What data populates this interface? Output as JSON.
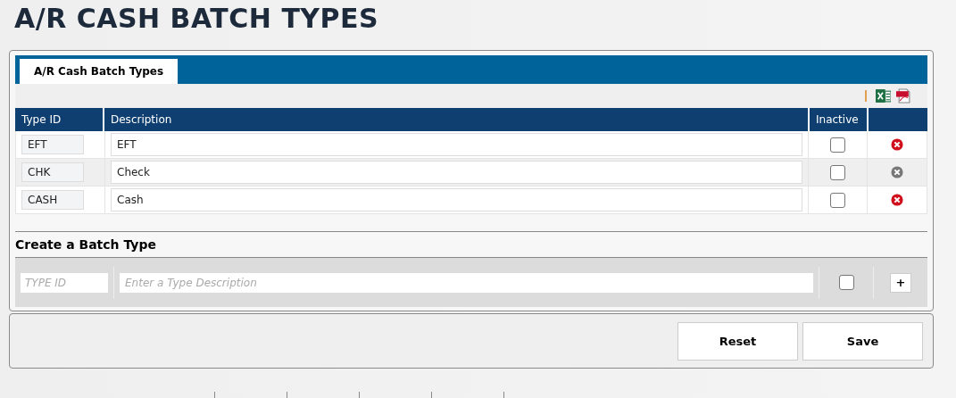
{
  "page_title": "A/R CASH BATCH TYPES",
  "tabs": [
    {
      "label": "A/R Cash Batch Types",
      "selected": true
    }
  ],
  "table": {
    "columns": [
      "Type ID",
      "Description",
      "Inactive"
    ],
    "rows": [
      {
        "type_id": "EFT",
        "description": "EFT",
        "inactive": false,
        "deletable": true
      },
      {
        "type_id": "CHK",
        "description": "Check",
        "inactive": false,
        "deletable": false
      },
      {
        "type_id": "CASH",
        "description": "Cash",
        "inactive": false,
        "deletable": true
      }
    ]
  },
  "create": {
    "title": "Create a Batch Type",
    "type_id_placeholder": "TYPE ID",
    "description_placeholder": "Enter a Type Description",
    "inactive": false,
    "add_label": "+"
  },
  "buttons": [
    "Reset",
    "Save"
  ]
}
